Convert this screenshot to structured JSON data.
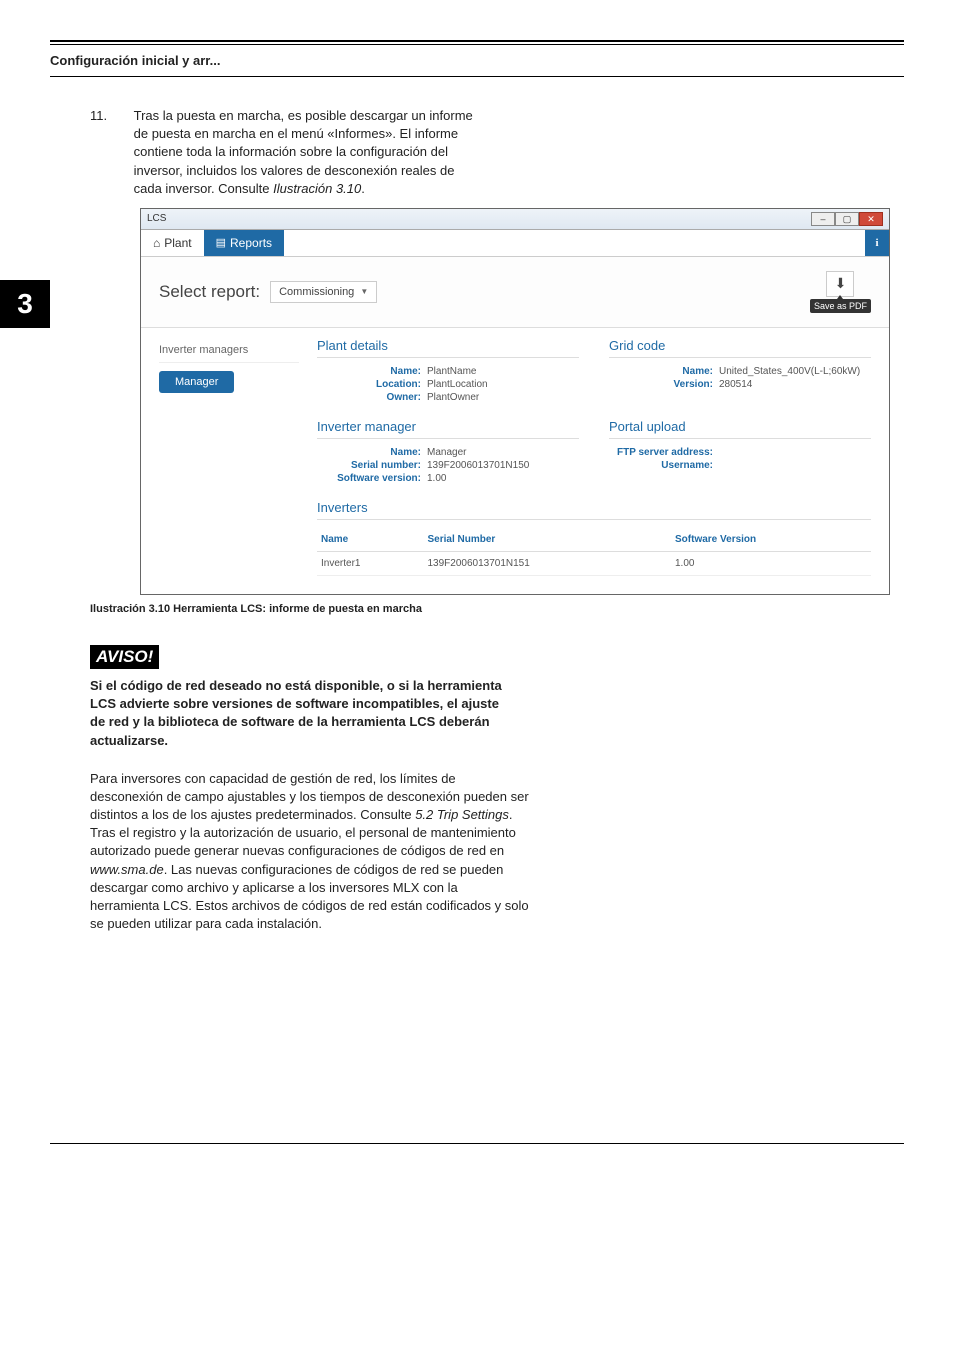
{
  "header": {
    "title": "Configuración inicial y arr..."
  },
  "section_number": "3",
  "step": {
    "num": "11.",
    "text_a": "Tras la puesta en marcha, es posible descargar un informe de puesta en marcha en el menú «Informes». El informe contiene toda la información sobre la configuración del inversor, incluidos los valores de desconexión reales de cada inversor. Consulte ",
    "text_ref": "Ilustración 3.10",
    "text_b": "."
  },
  "lcs": {
    "window_title": "LCS",
    "tabs": {
      "plant": "Plant",
      "reports": "Reports"
    },
    "info_glyph": "i",
    "select_report_label": "Select report:",
    "dropdown_value": "Commissioning",
    "save_as_pdf": "Save as PDF",
    "download_glyph": "⬇",
    "left": {
      "inverter_managers": "Inverter managers",
      "manager_btn": "Manager"
    },
    "plant_details": {
      "title": "Plant details",
      "name_k": "Name:",
      "name_v": "PlantName",
      "location_k": "Location:",
      "location_v": "PlantLocation",
      "owner_k": "Owner:",
      "owner_v": "PlantOwner"
    },
    "grid_code": {
      "title": "Grid code",
      "name_k": "Name:",
      "name_v": "United_States_400V(L-L;60kW)",
      "version_k": "Version:",
      "version_v": "280514"
    },
    "inv_mgr": {
      "title": "Inverter manager",
      "name_k": "Name:",
      "name_v": "Manager",
      "serial_k": "Serial number:",
      "serial_v": "139F2006013701N150",
      "sw_k": "Software version:",
      "sw_v": "1.00"
    },
    "portal": {
      "title": "Portal upload",
      "ftp_k": "FTP server address:",
      "ftp_v": "",
      "user_k": "Username:",
      "user_v": ""
    },
    "inverters": {
      "title": "Inverters",
      "col_name": "Name",
      "col_serial": "Serial Number",
      "col_sw": "Software Version",
      "rows": [
        {
          "name": "Inverter1",
          "serial": "139F2006013701N151",
          "sw": "1.00"
        }
      ]
    }
  },
  "caption": "Ilustración 3.10 Herramienta LCS: informe de puesta en marcha",
  "aviso": {
    "label": "AVISO!",
    "body": "Si el código de red deseado no está disponible, o si la herramienta LCS advierte sobre versiones de software incompatibles, el ajuste de red y la biblioteca de software de la herramienta LCS deberán actualizarse."
  },
  "para": {
    "a": "Para inversores con capacidad de gestión de red, los límites de desconexión de campo ajustables y los tiempos de desconexión pueden ser distintos a los de los ajustes predeterminados. Consulte ",
    "ref1": "5.2 Trip Settings",
    "b": ". Tras el registro y la autorización de usuario, el personal de mantenimiento autorizado puede generar nuevas configuraciones de códigos de red en ",
    "ref2": "www.sma.de",
    "c": ". Las nuevas configuraciones de códigos de red se pueden descargar como archivo y aplicarse a los inversores MLX con la herramienta LCS. Estos archivos de códigos de red están codificados y solo se pueden utilizar para cada instalación."
  }
}
